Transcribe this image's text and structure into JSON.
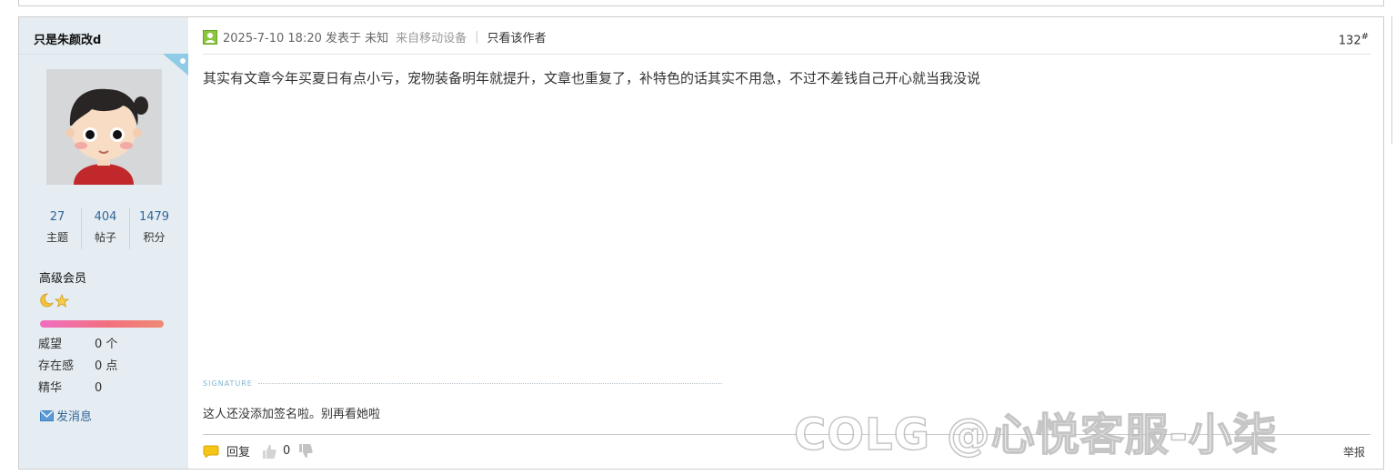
{
  "user": {
    "name": "只是朱颜改d",
    "stats": [
      {
        "value": "27",
        "label": "主题"
      },
      {
        "value": "404",
        "label": "帖子"
      },
      {
        "value": "1479",
        "label": "积分"
      }
    ],
    "level": "高级会员",
    "attributes": [
      {
        "key": "威望",
        "value": "0 个"
      },
      {
        "key": "存在感",
        "value": "0 点"
      },
      {
        "key": "精华",
        "value": "0"
      }
    ],
    "send_message": "发消息"
  },
  "post": {
    "timestamp": "2025-7-10 18:20 发表于 未知",
    "from_device": "来自移动设备",
    "separator": "|",
    "author_only": "只看该作者",
    "floor_number": "132",
    "floor_mark": "#",
    "content": "其实有文章今年买夏日有点小亏，宠物装备明年就提升，文章也重复了，补特色的话其实不用急，不过不差钱自己开心就当我没说",
    "signature_label": "SIGNATURE",
    "signature": "这人还没添加签名啦。别再看她啦",
    "actions": {
      "reply": "回复",
      "support_count": "0"
    },
    "report": "举报"
  },
  "watermark": "COLG @心悦客服-小柒",
  "colors": {
    "sidebar_bg": "#e5edf2",
    "link_blue": "#336699",
    "signature_blue": "#7cb5d0"
  }
}
